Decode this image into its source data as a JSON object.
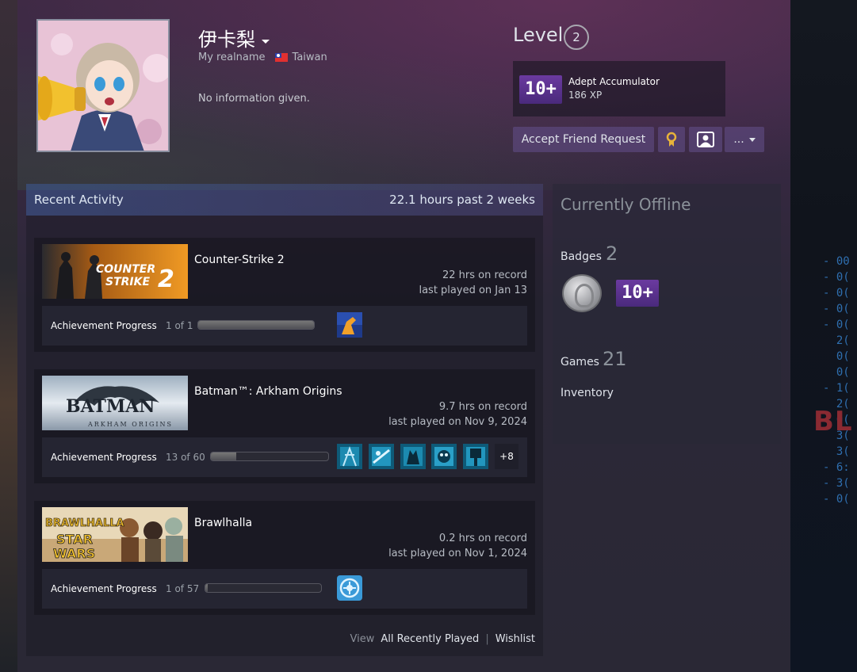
{
  "profile": {
    "persona_name": "伊卡梨",
    "real_name": "My realname",
    "country": "Taiwan",
    "summary": "No information given."
  },
  "level": {
    "label": "Level",
    "value": "2"
  },
  "featured_badge": {
    "icon_text": "10+",
    "name": "Adept Accumulator",
    "xp": "186 XP"
  },
  "actions": {
    "accept_friend": "Accept Friend Request",
    "more": "..."
  },
  "recent_activity": {
    "title": "Recent Activity",
    "hours_summary": "22.1 hours past 2 weeks",
    "games": [
      {
        "name": "Counter-Strike 2",
        "capsule_text": "COUNTER STRIKE 2",
        "hours": "22 hrs on record",
        "last_played": "last played on Jan 13",
        "achievement_label": "Achievement Progress",
        "achievement_count": "1 of 1",
        "achievement_progress": 1.0,
        "more_achievements": ""
      },
      {
        "name": "Batman™: Arkham Origins",
        "capsule_text": "BATMAN",
        "capsule_subtext": "ARKHAM ORIGINS",
        "hours": "9.7 hrs on record",
        "last_played": "last played on Nov 9, 2024",
        "achievement_label": "Achievement Progress",
        "achievement_count": "13 of 60",
        "achievement_progress": 0.217,
        "more_achievements": "+8"
      },
      {
        "name": "Brawlhalla",
        "capsule_text": "BRAWLHALLA",
        "capsule_subtext": "STAR WARS",
        "hours": "0.2 hrs on record",
        "last_played": "last played on Nov 1, 2024",
        "achievement_label": "Achievement Progress",
        "achievement_count": "1 of 57",
        "achievement_progress": 0.018,
        "more_achievements": ""
      }
    ],
    "footer": {
      "view": "View",
      "all_recently_played": "All Recently Played",
      "separator": "|",
      "wishlist": "Wishlist"
    }
  },
  "sidebar": {
    "status": "Currently Offline",
    "badges_label": "Badges",
    "badges_count": "2",
    "badge_icon_text": "10+",
    "games_label": "Games",
    "games_count": "21",
    "inventory_label": "Inventory"
  },
  "background_art": {
    "digits": "- 00\n- 0(\n- 0(\n- 0(\n- 0(\n  2(\n  0(\n  0(\n- 1(\n  2(\n  0(\n  3(\n  3(\n- 6:\n- 3(\n- 0(",
    "word": "BL"
  }
}
